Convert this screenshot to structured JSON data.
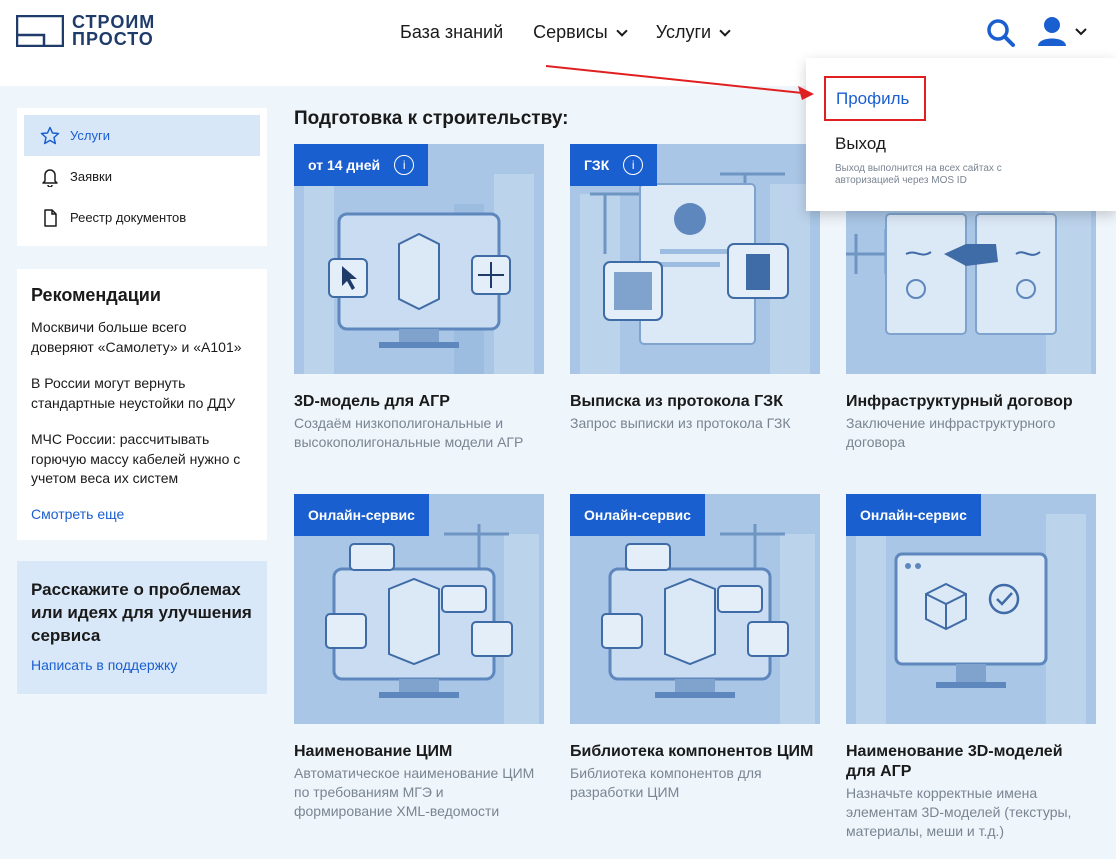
{
  "header": {
    "logo_line1": "СТРОИМ",
    "logo_line2": "ПРОСТО",
    "nav": [
      {
        "label": "База знаний"
      },
      {
        "label": "Сервисы"
      },
      {
        "label": "Услуги"
      }
    ],
    "search_icon": "search-icon",
    "user_icon": "user-icon"
  },
  "sidebar": {
    "items": [
      {
        "label": "Услуги",
        "icon": "star-icon",
        "active": true
      },
      {
        "label": "Заявки",
        "icon": "bell-icon"
      },
      {
        "label": "Реестр документов",
        "icon": "document-icon"
      }
    ]
  },
  "recommendations": {
    "title": "Рекомендации",
    "items": [
      "Москвичи больше всего доверяют «Самолету» и «А101»",
      "В России могут вернуть стандартные неустойки по ДДУ",
      "МЧС России: рассчитывать горючую массу кабелей нужно с учетом веса их систем"
    ],
    "more": "Смотреть еще"
  },
  "feedback": {
    "title": "Расскажите о проблемах или идеях для улучшения сервиса",
    "link": "Написать в поддержку"
  },
  "main": {
    "section_title": "Подготовка к строительству:",
    "cards": [
      {
        "badge": "от 14 дней",
        "has_info": true,
        "title": "3D-модель для АГР",
        "desc": "Создаём низкополигональные и высокополигональные модели АГР"
      },
      {
        "badge": "ГЗК",
        "has_info": true,
        "title": "Выписка из протокола ГЗК",
        "desc": "Запрос выписки из протокола ГЗК"
      },
      {
        "badge": "",
        "has_info": false,
        "title": "Инфраструктурный договор",
        "desc": "Заключение инфраструктурного договора"
      },
      {
        "badge": "Онлайн-сервис",
        "has_info": false,
        "title": "Наименование ЦИМ",
        "desc": "Автоматическое наименование ЦИМ по требованиям МГЭ и формирование XML-ведомости"
      },
      {
        "badge": "Онлайн-сервис",
        "has_info": false,
        "title": "Библиотека компонентов ЦИМ",
        "desc": "Библиотека компонентов для разработки ЦИМ"
      },
      {
        "badge": "Онлайн-сервис",
        "has_info": false,
        "title": "Наименование 3D-моделей для АГР",
        "desc": "Назначьте корректные имена элементам 3D-моделей (текстуры, материалы, меши и т.д.)"
      }
    ]
  },
  "dropdown": {
    "profile": "Профиль",
    "exit": "Выход",
    "note": "Выход выполнится на всех сайтах с авторизацией через MOS ID"
  },
  "colors": {
    "accent": "#1a5fd0",
    "highlight_border": "#e02020",
    "page_bg": "#eef5fb"
  }
}
